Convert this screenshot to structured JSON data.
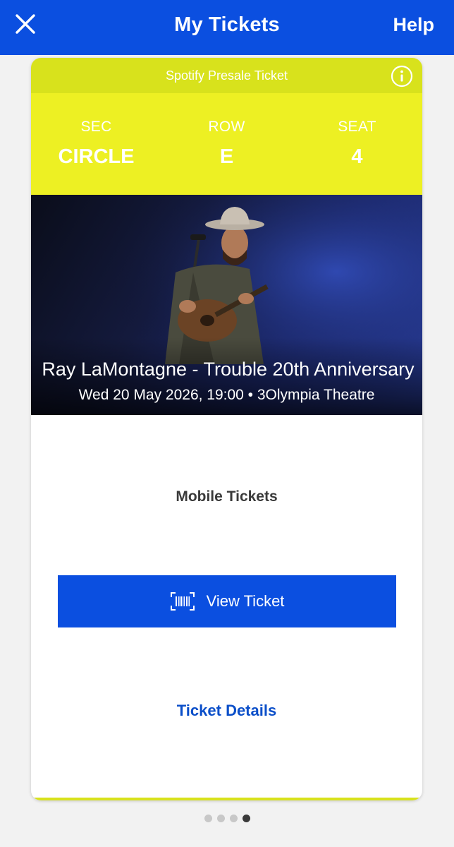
{
  "header": {
    "title": "My Tickets",
    "help_label": "Help",
    "close_icon": "close-icon",
    "bg_color": "#0b4fe0"
  },
  "ticket": {
    "banner": "Spotify Presale Ticket",
    "banner_color": "#d8e21c",
    "info_icon": "info-icon",
    "sec_label": "SEC",
    "sec_value": "CIRCLE",
    "row_label": "ROW",
    "row_value": "E",
    "seat_label": "SEAT",
    "seat_value": "4",
    "event_name": "Ray LaMontagne - Trouble 20th Anniversary",
    "event_meta": "Wed 20 May 2026, 19:00 • 3Olympia Theatre"
  },
  "actions": {
    "mobile_tickets": "Mobile Tickets",
    "view_ticket": "View Ticket",
    "barcode_icon": "barcode-icon",
    "ticket_details": "Ticket Details"
  },
  "pagination": {
    "pages": 4,
    "active_index": 3
  }
}
